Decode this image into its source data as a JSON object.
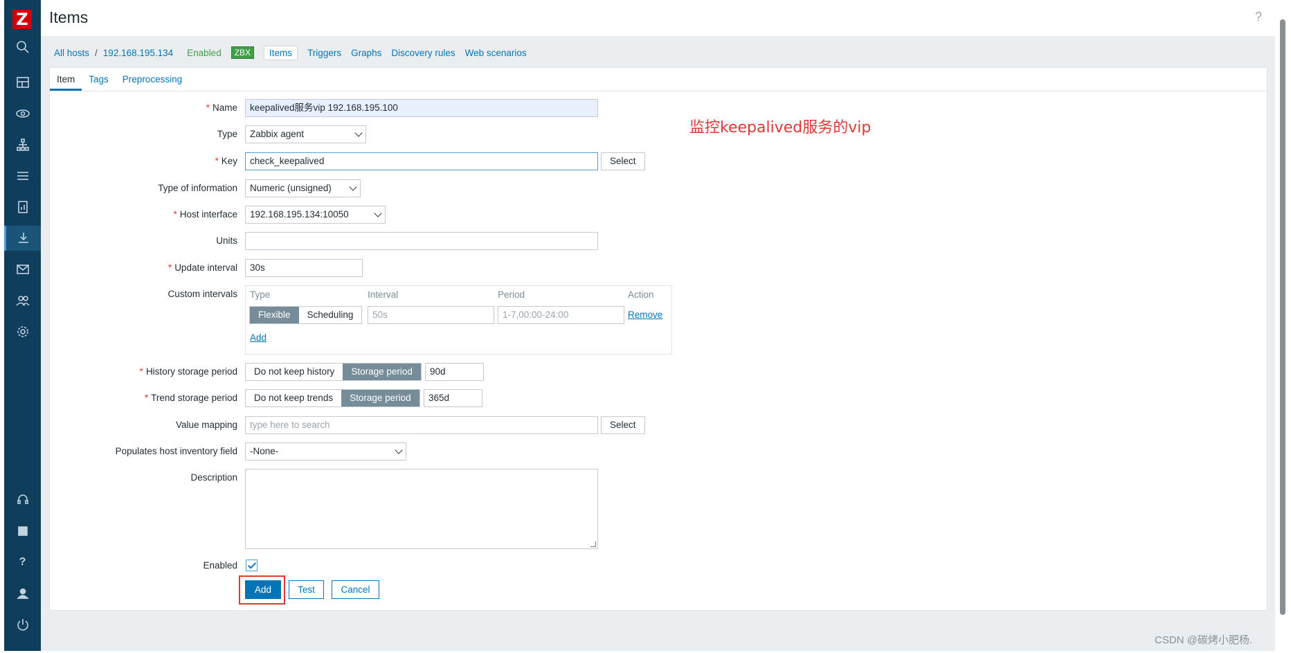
{
  "header": {
    "title": "Items",
    "help": "?"
  },
  "breadcrumb": {
    "all_hosts": "All hosts",
    "separator": "/",
    "host": "192.168.195.134",
    "status": "Enabled",
    "zbx": "ZBX",
    "nav": [
      "Items",
      "Triggers",
      "Graphs",
      "Discovery rules",
      "Web scenarios"
    ]
  },
  "tabs": [
    "Item",
    "Tags",
    "Preprocessing"
  ],
  "form": {
    "name_label": "Name",
    "name_value": "keepalived服务vip 192.168.195.100",
    "type_label": "Type",
    "type_value": "Zabbix agent",
    "key_label": "Key",
    "key_value": "check_keepalived",
    "select_label": "Select",
    "info_label": "Type of information",
    "info_value": "Numeric (unsigned)",
    "iface_label": "Host interface",
    "iface_value": "192.168.195.134:10050",
    "units_label": "Units",
    "units_value": "",
    "update_label": "Update interval",
    "update_value": "30s",
    "custom_label": "Custom intervals",
    "ci_headers": [
      "Type",
      "Interval",
      "Period",
      "Action"
    ],
    "ci_flexible": "Flexible",
    "ci_scheduling": "Scheduling",
    "ci_interval_placeholder": "50s",
    "ci_period_placeholder": "1-7,00:00-24:00",
    "ci_remove": "Remove",
    "ci_add": "Add",
    "history_label": "History storage period",
    "history_off": "Do not keep history",
    "history_on": "Storage period",
    "history_value": "90d",
    "trend_label": "Trend storage period",
    "trend_off": "Do not keep trends",
    "trend_on": "Storage period",
    "trend_value": "365d",
    "mapping_label": "Value mapping",
    "mapping_placeholder": "type here to search",
    "inventory_label": "Populates host inventory field",
    "inventory_value": "-None-",
    "description_label": "Description",
    "enabled_label": "Enabled",
    "add": "Add",
    "test": "Test",
    "cancel": "Cancel"
  },
  "annotation": "监控keepalived服务的vip",
  "watermark": "CSDN @碳烤小肥杨."
}
